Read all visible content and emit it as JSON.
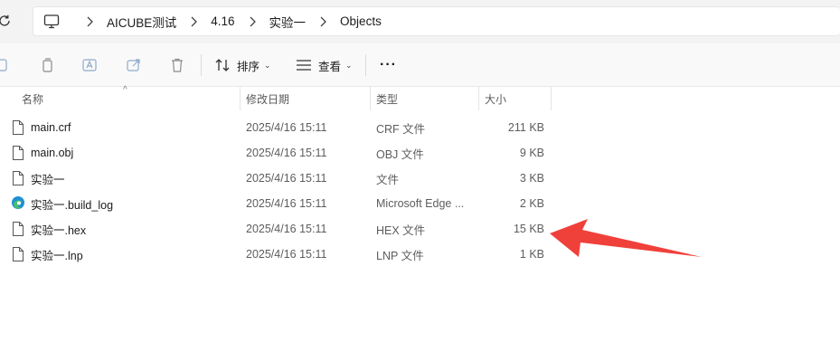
{
  "address": {
    "breadcrumbs": [
      "AICUBE测试",
      "4.16",
      "实验一",
      "Objects"
    ]
  },
  "toolbar": {
    "sort_label": "排序",
    "view_label": "查看",
    "more_label": "···"
  },
  "columns": {
    "name": "名称",
    "date": "修改日期",
    "type": "类型",
    "size": "大小"
  },
  "files": [
    {
      "name": "main.crf",
      "date": "2025/4/16 15:11",
      "type": "CRF 文件",
      "size": "211 KB",
      "icon": "file-icon"
    },
    {
      "name": "main.obj",
      "date": "2025/4/16 15:11",
      "type": "OBJ 文件",
      "size": "9 KB",
      "icon": "file-icon"
    },
    {
      "name": "实验一",
      "date": "2025/4/16 15:11",
      "type": "文件",
      "size": "3 KB",
      "icon": "file-icon"
    },
    {
      "name": "实验一.build_log",
      "date": "2025/4/16 15:11",
      "type": "Microsoft Edge ...",
      "size": "2 KB",
      "icon": "edge-icon"
    },
    {
      "name": "实验一.hex",
      "date": "2025/4/16 15:11",
      "type": "HEX 文件",
      "size": "15 KB",
      "icon": "file-icon"
    },
    {
      "name": "实验一.lnp",
      "date": "2025/4/16 15:11",
      "type": "LNP 文件",
      "size": "1 KB",
      "icon": "file-icon"
    }
  ],
  "colors": {
    "annotation_arrow": "#f0403a",
    "addr_bg": "#f3f3f3",
    "toolbar_bg": "#f9f9f9"
  }
}
